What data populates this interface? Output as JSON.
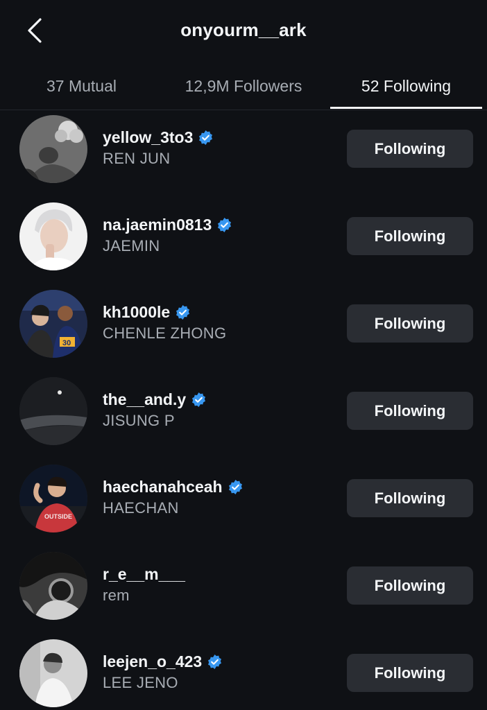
{
  "header": {
    "title": "onyourm__ark",
    "back_icon": "chevron-left-icon"
  },
  "tabs": [
    {
      "label": "37 Mutual",
      "active": false
    },
    {
      "label": "12,9M Followers",
      "active": false
    },
    {
      "label": "52 Following",
      "active": true
    }
  ],
  "colors": {
    "background": "#0f1115",
    "button": "#2a2d33",
    "verified": "#3897f0",
    "secondary_text": "#a8adb4"
  },
  "accounts": [
    {
      "username": "yellow_3to3",
      "full_name": "REN JUN",
      "verified": true,
      "button_label": "Following"
    },
    {
      "username": "na.jaemin0813",
      "full_name": "JAEMIN",
      "verified": true,
      "button_label": "Following"
    },
    {
      "username": "kh1000le",
      "full_name": "CHENLE ZHONG",
      "verified": true,
      "button_label": "Following"
    },
    {
      "username": "the__and.y",
      "full_name": "JISUNG P",
      "verified": true,
      "button_label": "Following"
    },
    {
      "username": "haechanahceah",
      "full_name": "HAECHAN",
      "verified": true,
      "button_label": "Following"
    },
    {
      "username": "r_e__m___",
      "full_name": "rem",
      "verified": false,
      "button_label": "Following"
    },
    {
      "username": "leejen_o_423",
      "full_name": "LEE JENO",
      "verified": true,
      "button_label": "Following"
    }
  ]
}
